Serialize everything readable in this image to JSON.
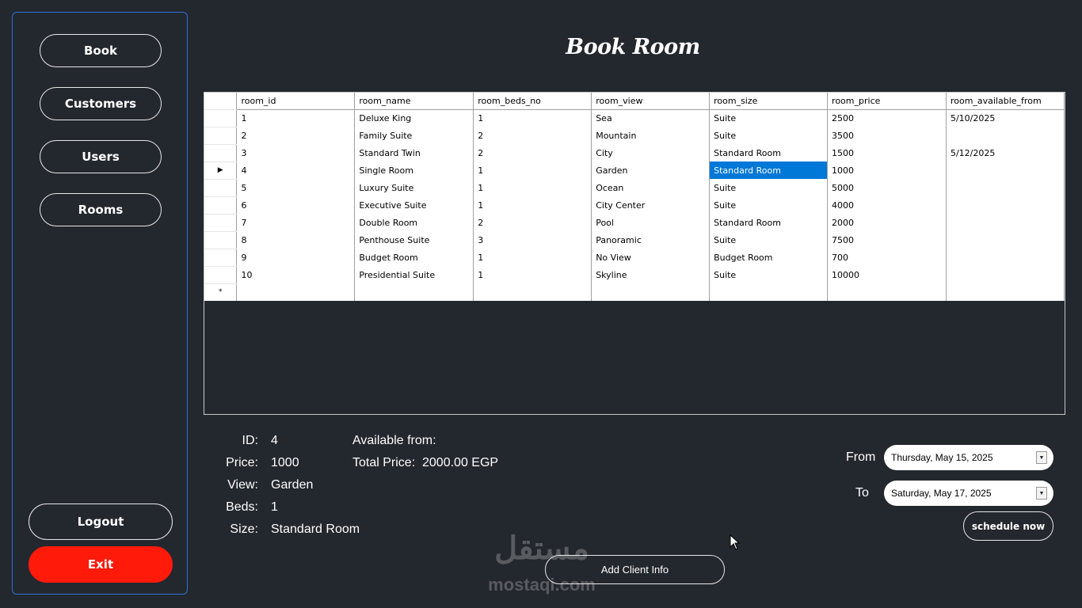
{
  "sidebar": {
    "items": [
      {
        "label": "Book"
      },
      {
        "label": "Customers"
      },
      {
        "label": "Users"
      },
      {
        "label": "Rooms"
      }
    ],
    "logout_label": "Logout",
    "exit_label": "Exit"
  },
  "page": {
    "title": "Book Room"
  },
  "grid": {
    "columns": [
      "room_id",
      "room_name",
      "room_beds_no",
      "room_view",
      "room_size",
      "room_price",
      "room_available_from"
    ],
    "rows": [
      [
        "1",
        "Deluxe King",
        "1",
        "Sea",
        "Suite",
        "2500",
        "5/10/2025"
      ],
      [
        "2",
        "Family Suite",
        "2",
        "Mountain",
        "Suite",
        "3500",
        ""
      ],
      [
        "3",
        "Standard Twin",
        "2",
        "City",
        "Standard Room",
        "1500",
        "5/12/2025"
      ],
      [
        "4",
        "Single Room",
        "1",
        "Garden",
        "Standard Room",
        "1000",
        ""
      ],
      [
        "5",
        "Luxury Suite",
        "1",
        "Ocean",
        "Suite",
        "5000",
        ""
      ],
      [
        "6",
        "Executive Suite",
        "1",
        "City Center",
        "Suite",
        "4000",
        ""
      ],
      [
        "7",
        "Double Room",
        "2",
        "Pool",
        "Standard Room",
        "2000",
        ""
      ],
      [
        "8",
        "Penthouse Suite",
        "3",
        "Panoramic",
        "Suite",
        "7500",
        ""
      ],
      [
        "9",
        "Budget Room",
        "1",
        "No View",
        "Budget Room",
        "700",
        ""
      ],
      [
        "10",
        "Presidential Suite",
        "1",
        "Skyline",
        "Suite",
        "10000",
        ""
      ]
    ],
    "current_row_marker": "▶",
    "new_row_marker": "*",
    "selected_row": 4,
    "selected_column": "room_size"
  },
  "details": {
    "id_label": "ID:",
    "id_value": "4",
    "price_label": "Price:",
    "price_value": "1000",
    "view_label": "View:",
    "view_value": "Garden",
    "beds_label": "Beds:",
    "beds_value": "1",
    "size_label": "Size:",
    "size_value": "Standard Room",
    "available_label": "Available from:",
    "total_label": "Total Price:",
    "total_value": "2000.00 EGP"
  },
  "booking": {
    "from_label": "From",
    "from_value": "Thursday, May 15, 2025",
    "to_label": "To",
    "to_value": "Saturday, May 17, 2025",
    "schedule_label": "schedule now",
    "add_client_label": "Add Client Info"
  },
  "watermark": {
    "arabic": "مستقل",
    "latin": "mostaqi.com"
  },
  "colors": {
    "background": "#23272e",
    "sidebar_border": "#2f6fd6",
    "exit": "#ff1a0a",
    "selection": "#0078d7"
  }
}
